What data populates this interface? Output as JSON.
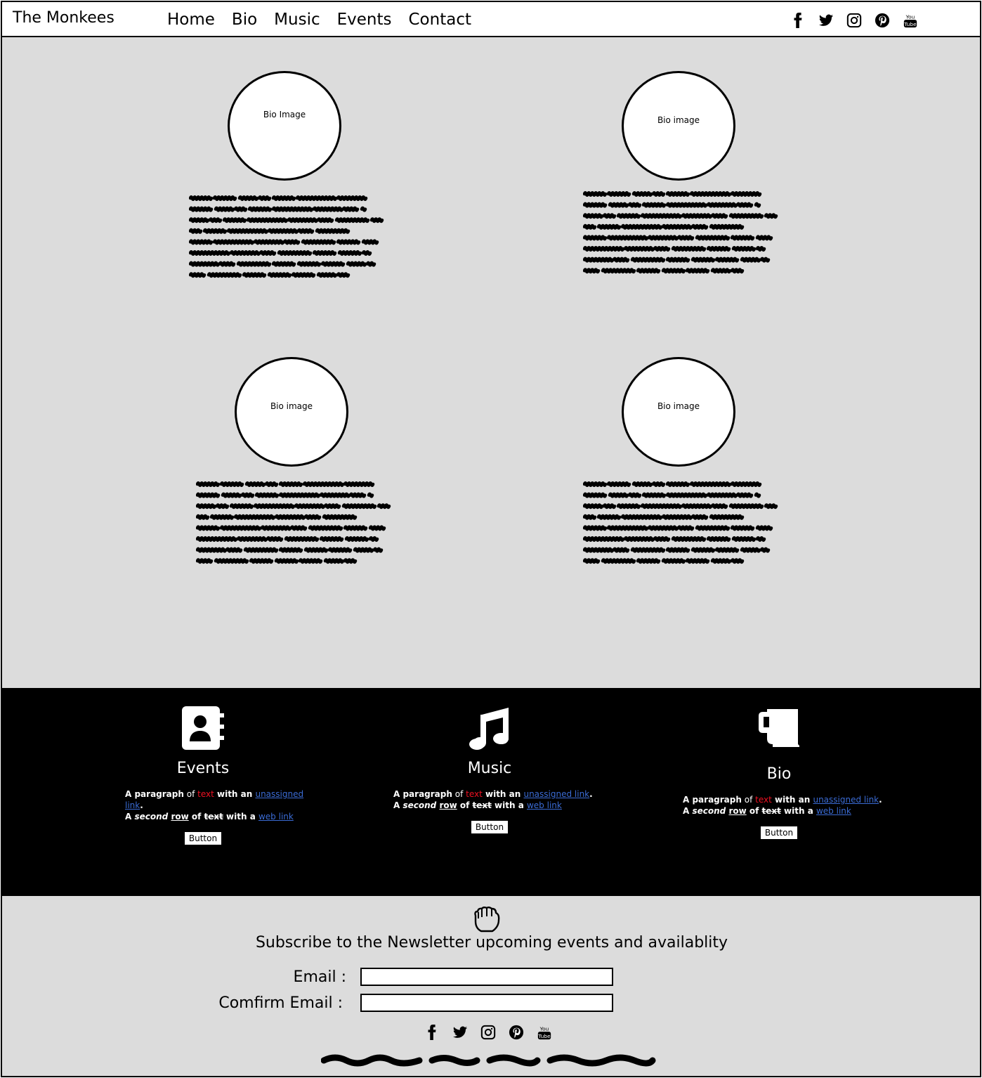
{
  "header": {
    "brand": "The Monkees",
    "nav": [
      "Home",
      "Bio",
      "Music",
      "Events",
      "Contact"
    ],
    "social_icons": [
      "facebook-icon",
      "twitter-icon",
      "instagram-icon",
      "pinterest-icon",
      "youtube-icon"
    ]
  },
  "bios": [
    {
      "image_label": "Bio Image"
    },
    {
      "image_label": "Bio image"
    },
    {
      "image_label": "Bio image"
    },
    {
      "image_label": "Bio image"
    }
  ],
  "features": [
    {
      "icon": "address-book-icon",
      "title": "Events",
      "line1": {
        "a": "A ",
        "b": "paragraph",
        "c": " of ",
        "red": "text",
        "d": " with an ",
        "link": "unassigned link",
        "e": "."
      },
      "line2": {
        "a": "A ",
        "italic": "second",
        "u": "row",
        "b": " of ",
        "strike": "text",
        "c": " with a ",
        "link": "web link"
      },
      "button": "Button"
    },
    {
      "icon": "music-note-icon",
      "title": "Music",
      "line1": {
        "a": "A ",
        "b": "paragraph",
        "c": " of ",
        "red": "text",
        "d": " with an ",
        "link": "unassigned link",
        "e": "."
      },
      "line2": {
        "a": "A ",
        "italic": "second",
        "u": "row",
        "b": " of ",
        "strike": "text",
        "c": " with a ",
        "link": "web link"
      },
      "button": "Button"
    },
    {
      "icon": "coffee-mug-icon",
      "title": "Bio",
      "line1": {
        "a": "A ",
        "b": "paragraph",
        "c": " of ",
        "red": "text",
        "d": " with an ",
        "link": "unassigned link",
        "e": "."
      },
      "line2": {
        "a": "A ",
        "italic": "second",
        "u": "row",
        "b": " of ",
        "strike": "text",
        "c": " with a ",
        "link": "web link"
      },
      "button": "Button"
    }
  ],
  "newsletter": {
    "icon": "fist-icon",
    "title": "Subscribe to the Newsletter upcoming events and availablity",
    "email_label": "Email :",
    "confirm_label": "Comfirm Email :",
    "email_value": "",
    "confirm_value": ""
  },
  "colors": {
    "background": "#dcdcdc",
    "footer": "#000000",
    "red_text": "#ee1122",
    "link": "#3a6bd4"
  }
}
